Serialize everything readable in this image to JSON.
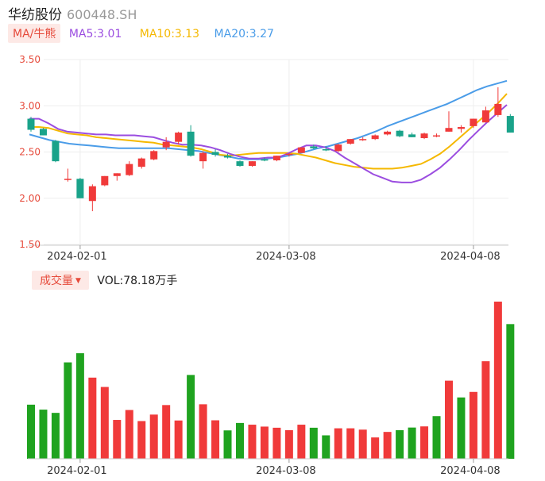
{
  "header": {
    "name": "华纺股份",
    "code": "600448.SH"
  },
  "legend": {
    "tag": "MA/牛熊",
    "ma5": "MA5:3.01",
    "ma10": "MA10:3.13",
    "ma20": "MA20:3.27"
  },
  "volume_legend": {
    "tag": "成交量",
    "value": "VOL:78.18万手"
  },
  "colors": {
    "up": "#f03a3a",
    "down": "#1aa38a",
    "vol_down": "#1fa31f",
    "ma5": "#9b4de0",
    "ma10": "#f5b800",
    "ma20": "#4a9ce8",
    "axis_label": "#e64a3b"
  },
  "chart_data": [
    {
      "type": "candlestick",
      "title": "",
      "ylim": [
        1.5,
        3.5
      ],
      "y_ticks": [
        "3.50",
        "3.00",
        "2.50",
        "2.00",
        "1.50"
      ],
      "x_tick_labels": [
        "2024-02-01",
        "2024-03-08",
        "2024-04-08"
      ],
      "x_tick_index": [
        4,
        21,
        36
      ],
      "grid": true,
      "candles": [
        {
          "o": 2.86,
          "h": 2.88,
          "l": 2.72,
          "c": 2.74
        },
        {
          "o": 2.75,
          "h": 2.76,
          "l": 2.68,
          "c": 2.68
        },
        {
          "o": 2.62,
          "h": 2.63,
          "l": 2.39,
          "c": 2.4
        },
        {
          "o": 2.2,
          "h": 2.32,
          "l": 2.18,
          "c": 2.21
        },
        {
          "o": 2.21,
          "h": 2.22,
          "l": 2.0,
          "c": 2.0
        },
        {
          "o": 1.97,
          "h": 2.15,
          "l": 1.86,
          "c": 2.13
        },
        {
          "o": 2.14,
          "h": 2.24,
          "l": 2.13,
          "c": 2.24
        },
        {
          "o": 2.24,
          "h": 2.27,
          "l": 2.19,
          "c": 2.27
        },
        {
          "o": 2.25,
          "h": 2.4,
          "l": 2.24,
          "c": 2.37
        },
        {
          "o": 2.34,
          "h": 2.44,
          "l": 2.32,
          "c": 2.43
        },
        {
          "o": 2.42,
          "h": 2.52,
          "l": 2.41,
          "c": 2.51
        },
        {
          "o": 2.55,
          "h": 2.66,
          "l": 2.52,
          "c": 2.61
        },
        {
          "o": 2.61,
          "h": 2.72,
          "l": 2.58,
          "c": 2.71
        },
        {
          "o": 2.72,
          "h": 2.79,
          "l": 2.45,
          "c": 2.46
        },
        {
          "o": 2.4,
          "h": 2.51,
          "l": 2.32,
          "c": 2.49
        },
        {
          "o": 2.5,
          "h": 2.53,
          "l": 2.45,
          "c": 2.47
        },
        {
          "o": 2.46,
          "h": 2.48,
          "l": 2.43,
          "c": 2.44
        },
        {
          "o": 2.4,
          "h": 2.41,
          "l": 2.34,
          "c": 2.35
        },
        {
          "o": 2.35,
          "h": 2.4,
          "l": 2.34,
          "c": 2.4
        },
        {
          "o": 2.42,
          "h": 2.44,
          "l": 2.4,
          "c": 2.41
        },
        {
          "o": 2.41,
          "h": 2.46,
          "l": 2.4,
          "c": 2.46
        },
        {
          "o": 2.47,
          "h": 2.49,
          "l": 2.45,
          "c": 2.48
        },
        {
          "o": 2.49,
          "h": 2.55,
          "l": 2.49,
          "c": 2.55
        },
        {
          "o": 2.56,
          "h": 2.58,
          "l": 2.53,
          "c": 2.54
        },
        {
          "o": 2.53,
          "h": 2.56,
          "l": 2.51,
          "c": 2.52
        },
        {
          "o": 2.51,
          "h": 2.59,
          "l": 2.5,
          "c": 2.58
        },
        {
          "o": 2.59,
          "h": 2.64,
          "l": 2.58,
          "c": 2.64
        },
        {
          "o": 2.63,
          "h": 2.66,
          "l": 2.62,
          "c": 2.64
        },
        {
          "o": 2.64,
          "h": 2.69,
          "l": 2.63,
          "c": 2.68
        },
        {
          "o": 2.69,
          "h": 2.73,
          "l": 2.68,
          "c": 2.72
        },
        {
          "o": 2.73,
          "h": 2.74,
          "l": 2.66,
          "c": 2.67
        },
        {
          "o": 2.69,
          "h": 2.71,
          "l": 2.66,
          "c": 2.66
        },
        {
          "o": 2.65,
          "h": 2.71,
          "l": 2.64,
          "c": 2.7
        },
        {
          "o": 2.68,
          "h": 2.7,
          "l": 2.66,
          "c": 2.68
        },
        {
          "o": 2.72,
          "h": 2.94,
          "l": 2.72,
          "c": 2.76
        },
        {
          "o": 2.75,
          "h": 2.79,
          "l": 2.71,
          "c": 2.77
        },
        {
          "o": 2.78,
          "h": 2.86,
          "l": 2.76,
          "c": 2.86
        },
        {
          "o": 2.82,
          "h": 2.99,
          "l": 2.82,
          "c": 2.95
        },
        {
          "o": 2.9,
          "h": 3.2,
          "l": 2.88,
          "c": 3.02
        },
        {
          "o": 2.89,
          "h": 2.91,
          "l": 2.71,
          "c": 2.71
        }
      ],
      "ma5": [
        2.86,
        2.86,
        2.81,
        2.75,
        2.72,
        2.71,
        2.7,
        2.69,
        2.69,
        2.68,
        2.68,
        2.68,
        2.67,
        2.66,
        2.63,
        2.6,
        2.58,
        2.58,
        2.57,
        2.55,
        2.52,
        2.48,
        2.45,
        2.43,
        2.43,
        2.44,
        2.44,
        2.48,
        2.53,
        2.57,
        2.57,
        2.55,
        2.51,
        2.44,
        2.38,
        2.32,
        2.26,
        2.22,
        2.18,
        2.17,
        2.17,
        2.2,
        2.26,
        2.33,
        2.42,
        2.52,
        2.63,
        2.73,
        2.83,
        2.92,
        3.01
      ],
      "ma10": [
        2.77,
        2.77,
        2.76,
        2.73,
        2.7,
        2.69,
        2.68,
        2.66,
        2.65,
        2.64,
        2.63,
        2.62,
        2.61,
        2.6,
        2.58,
        2.57,
        2.56,
        2.55,
        2.53,
        2.5,
        2.47,
        2.46,
        2.47,
        2.48,
        2.49,
        2.49,
        2.49,
        2.49,
        2.48,
        2.46,
        2.44,
        2.41,
        2.38,
        2.36,
        2.34,
        2.33,
        2.32,
        2.32,
        2.32,
        2.33,
        2.35,
        2.37,
        2.42,
        2.48,
        2.56,
        2.65,
        2.74,
        2.83,
        2.92,
        3.02,
        3.13
      ],
      "ma20": [
        2.69,
        2.66,
        2.63,
        2.61,
        2.59,
        2.58,
        2.57,
        2.56,
        2.55,
        2.54,
        2.54,
        2.54,
        2.54,
        2.54,
        2.54,
        2.53,
        2.52,
        2.51,
        2.49,
        2.47,
        2.45,
        2.43,
        2.42,
        2.42,
        2.43,
        2.44,
        2.46,
        2.48,
        2.51,
        2.54,
        2.56,
        2.59,
        2.62,
        2.65,
        2.69,
        2.73,
        2.78,
        2.82,
        2.86,
        2.9,
        2.94,
        2.98,
        3.02,
        3.07,
        3.12,
        3.17,
        3.21,
        3.24,
        3.27
      ]
    },
    {
      "type": "bar",
      "title": "",
      "value_unit": "万手",
      "values": [
        {
          "v": 28.4,
          "up": false
        },
        {
          "v": 25.8,
          "up": false
        },
        {
          "v": 24.1,
          "up": false
        },
        {
          "v": 50.6,
          "up": false
        },
        {
          "v": 55.4,
          "up": false
        },
        {
          "v": 42.6,
          "up": true
        },
        {
          "v": 37.7,
          "up": true
        },
        {
          "v": 20.4,
          "up": true
        },
        {
          "v": 25.6,
          "up": true
        },
        {
          "v": 19.8,
          "up": true
        },
        {
          "v": 23.2,
          "up": true
        },
        {
          "v": 28.2,
          "up": true
        },
        {
          "v": 20.1,
          "up": true
        },
        {
          "v": 44.0,
          "up": false
        },
        {
          "v": 28.6,
          "up": true
        },
        {
          "v": 20.2,
          "up": true
        },
        {
          "v": 14.9,
          "up": false
        },
        {
          "v": 18.8,
          "up": false
        },
        {
          "v": 17.9,
          "up": true
        },
        {
          "v": 16.9,
          "up": true
        },
        {
          "v": 16.3,
          "up": true
        },
        {
          "v": 15.0,
          "up": true
        },
        {
          "v": 17.9,
          "up": true
        },
        {
          "v": 16.3,
          "up": false
        },
        {
          "v": 12.3,
          "up": false
        },
        {
          "v": 16.0,
          "up": true
        },
        {
          "v": 16.0,
          "up": true
        },
        {
          "v": 15.3,
          "up": true
        },
        {
          "v": 11.2,
          "up": true
        },
        {
          "v": 14.1,
          "up": true
        },
        {
          "v": 15.0,
          "up": false
        },
        {
          "v": 16.4,
          "up": false
        },
        {
          "v": 17.0,
          "up": true
        },
        {
          "v": 22.4,
          "up": false
        },
        {
          "v": 41.0,
          "up": true
        },
        {
          "v": 32.2,
          "up": false
        },
        {
          "v": 35.1,
          "up": true
        },
        {
          "v": 51.2,
          "up": true
        },
        {
          "v": 82.5,
          "up": true
        },
        {
          "v": 70.7,
          "up": false
        }
      ],
      "x_tick_labels": [
        "2024-02-01",
        "2024-03-08",
        "2024-04-08"
      ],
      "x_tick_index": [
        4,
        21,
        36
      ]
    }
  ]
}
